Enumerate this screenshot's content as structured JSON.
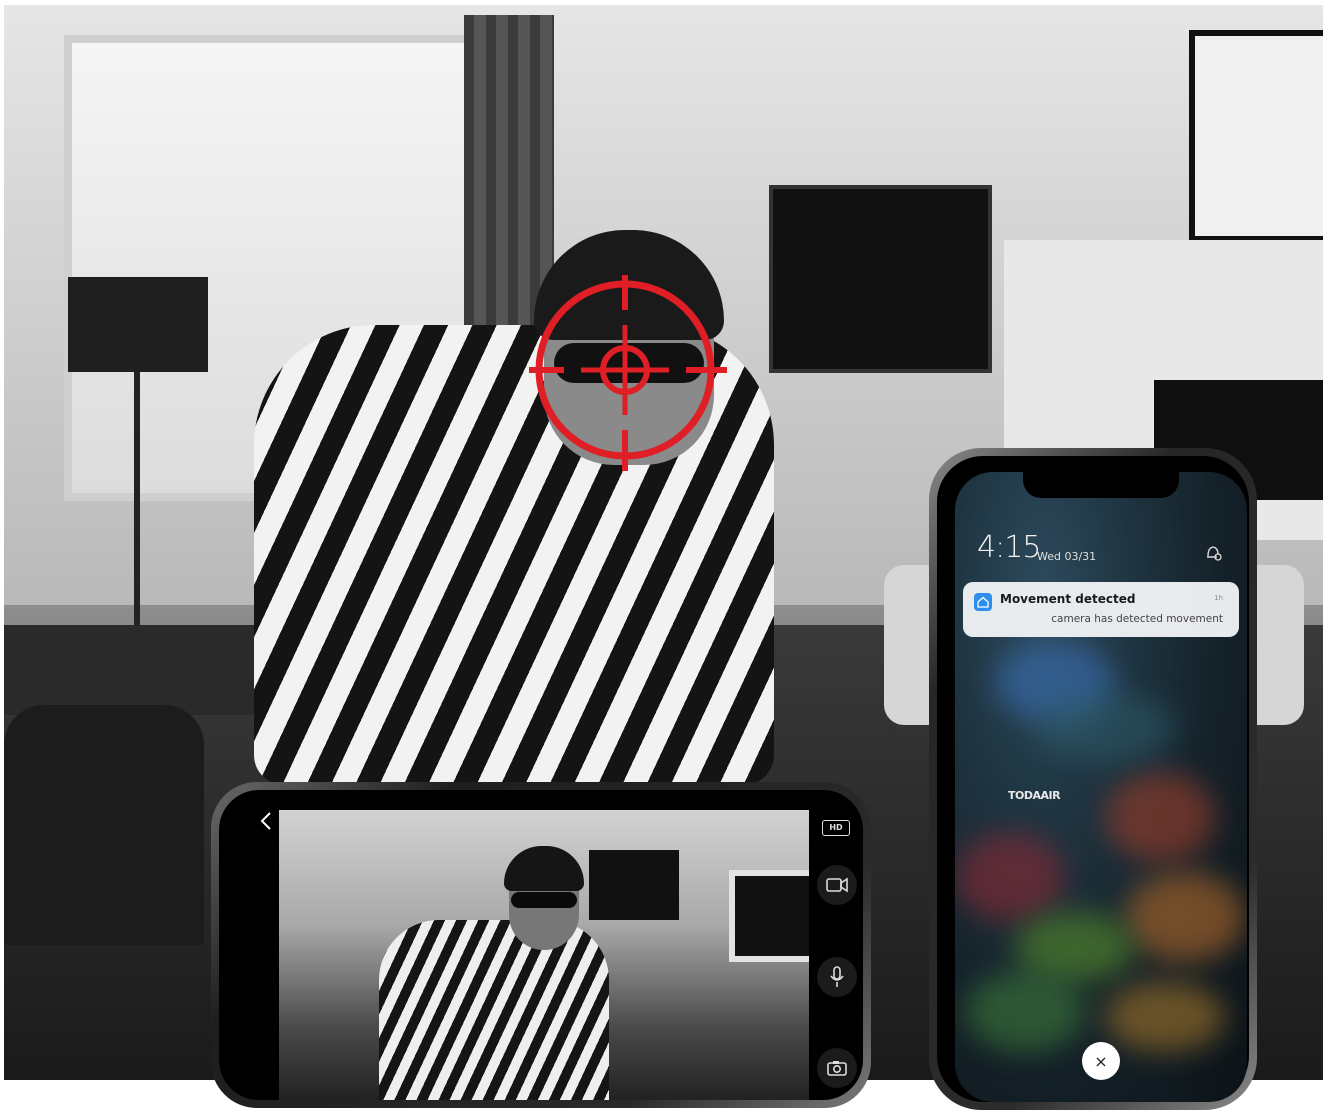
{
  "scene": {
    "description_icon": "security-camera-scene",
    "accent_color": "#e01e26"
  },
  "camera_app": {
    "quality_badge": "HD",
    "back_icon": "chevron-left-icon",
    "record_icon": "video-camera-icon",
    "mic_icon": "microphone-icon",
    "snapshot_icon": "camera-icon"
  },
  "lock_screen": {
    "time": "4:15",
    "date": "Wed 03/31",
    "brand_label": "TODAAIR",
    "notification": {
      "title": "Movement detected",
      "message": "camera has detected movement",
      "age": "1h",
      "app_icon": "home-icon",
      "app_icon_color": "#2e8ef0"
    },
    "dismiss_label": "×"
  }
}
